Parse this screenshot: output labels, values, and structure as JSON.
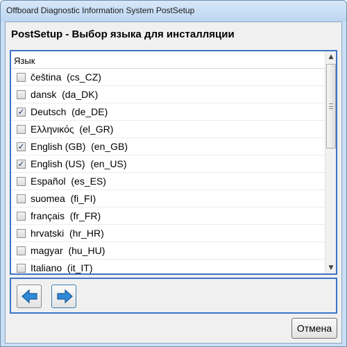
{
  "window": {
    "title": "Offboard Diagnostic Information System PostSetup"
  },
  "page": {
    "heading": "PostSetup - Выбор языка для инсталляции"
  },
  "language_list": {
    "column_header": "Язык",
    "items": [
      {
        "label": "čeština  (cs_CZ)",
        "checked": false
      },
      {
        "label": "dansk  (da_DK)",
        "checked": false
      },
      {
        "label": "Deutsch  (de_DE)",
        "checked": true
      },
      {
        "label": "Ελληνικός  (el_GR)",
        "checked": false
      },
      {
        "label": "English (GB)  (en_GB)",
        "checked": true
      },
      {
        "label": "English (US)  (en_US)",
        "checked": true
      },
      {
        "label": "Español  (es_ES)",
        "checked": false
      },
      {
        "label": "suomea  (fi_FI)",
        "checked": false
      },
      {
        "label": "français  (fr_FR)",
        "checked": false
      },
      {
        "label": "hrvatski  (hr_HR)",
        "checked": false
      },
      {
        "label": "magyar  (hu_HU)",
        "checked": false
      },
      {
        "label": "Italiano  (it_IT)",
        "checked": false
      }
    ]
  },
  "navigation": {
    "back_icon": "arrow-left-icon",
    "next_icon": "arrow-right-icon"
  },
  "footer": {
    "cancel_label": "Отмена"
  },
  "colors": {
    "accent_border": "#3b73c6",
    "arrow_fill": "#2f8ad8"
  }
}
